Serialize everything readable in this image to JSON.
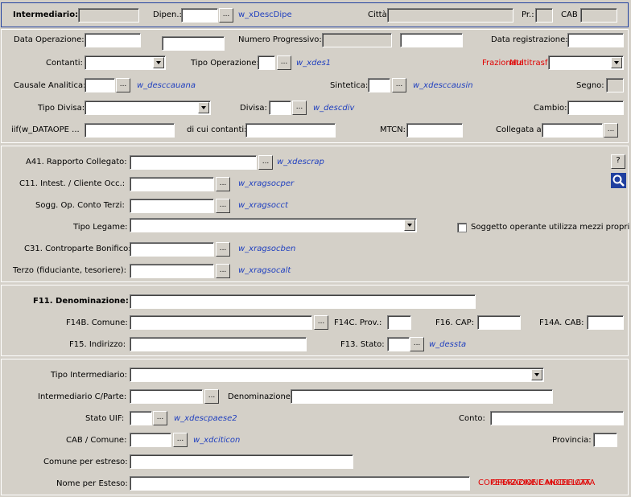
{
  "section1": {
    "intermediario": "Intermediario:",
    "dipen": "Dipen.:",
    "w_xdescdipe": "w_xDescDipe",
    "citta": "Città:",
    "pr": "Pr.:",
    "cab": "CAB"
  },
  "section2": {
    "data_operazione": "Data Operazione:",
    "numero_progressivo": "Numero Progressivo:",
    "data_registrazione": "Data registrazione:",
    "contanti": "Contanti:",
    "tipo_operazione": "Tipo Operazione:",
    "w_xdes1": "w_xdes1",
    "frazionata": "Frazionata",
    "multitrasferita": "Multitrasferita",
    "causale_analitica": "Causale Analitica:",
    "w_desccauana": "w_desccauana",
    "sintetica": "Sintetica:",
    "w_xdesccausin": "w_xdesccausin",
    "segno": "Segno:",
    "tipo_divisa": "Tipo Divisa:",
    "divisa": "Divisa:",
    "w_descdiv": "w_descdiv",
    "cambio": "Cambio:",
    "iif_dataope": "iif(w_DATAOPE ...",
    "di_cui_contanti": "di cui contanti:",
    "mtcn": "MTCN:",
    "collegata_a": "Collegata a:"
  },
  "section3": {
    "a41": "A41. Rapporto Collegato:",
    "w_xdescrap": "w_xdescrap",
    "help_btn": "?",
    "c11": "C11. Intest. / Cliente Occ.:",
    "w_xragsocper": "w_xragsocper",
    "sogg_op": "Sogg. Op. Conto Terzi:",
    "w_xragsocct": "w_xragsocct",
    "tipo_legame": "Tipo Legame:",
    "soggetto_operante": "Soggetto operante utilizza mezzi propri",
    "c31": "C31. Controparte Bonifico:",
    "w_xragsocben": "w_xragsocben",
    "terzo": "Terzo (fiduciante, tesoriere):",
    "w_xragsocalt": "w_xragsocalt"
  },
  "section4": {
    "f11": "F11. Denominazione:",
    "f14b": "F14B. Comune:",
    "f14c": "F14C. Prov.:",
    "f16": "F16. CAP:",
    "f14a": "F14A. CAB:",
    "f15": "F15. Indirizzo:",
    "f13": "F13. Stato:",
    "w_dessta": "w_dessta"
  },
  "section5": {
    "tipo_intermediario": "Tipo Intermediario:",
    "intermediario_cparte": "Intermediario C/Parte:",
    "denominazione": "Denominazione:",
    "stato_uif": "Stato UIF:",
    "w_xdescpaese2": "w_xdescpaese2",
    "conto": "Conto:",
    "cab_comune": "CAB / Comune:",
    "w_xdciticon": "w_xdciticon",
    "provincia": "Provincia:",
    "comune_estreso": "Comune per estreso:",
    "nome_esteso": "Nome per Esteso:",
    "red_overlap_1": "COPERAZIONE CANCELLATA",
    "red_overlap_2": "OPERAZIONE MODIFICATA"
  },
  "button_glyph": "..."
}
